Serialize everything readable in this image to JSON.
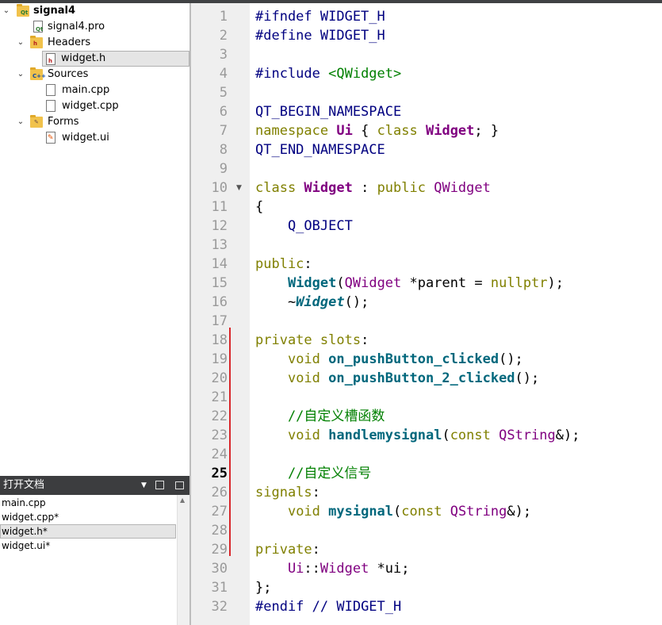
{
  "project_tree": {
    "project": "signal4",
    "pro_file": "signal4.pro",
    "headers_label": "Headers",
    "headers": [
      "widget.h"
    ],
    "sources_label": "Sources",
    "sources": [
      "main.cpp",
      "widget.cpp"
    ],
    "forms_label": "Forms",
    "forms": [
      "widget.ui"
    ]
  },
  "open_docs": {
    "title": "打开文档",
    "items": [
      "main.cpp",
      "widget.cpp*",
      "widget.h*",
      "widget.ui*"
    ],
    "selected_index": 2
  },
  "editor": {
    "current_line": 25,
    "lines": [
      {
        "n": "1",
        "tokens": [
          {
            "t": "#ifndef WIDGET_H",
            "c": "pp"
          }
        ]
      },
      {
        "n": "2",
        "tokens": [
          {
            "t": "#define WIDGET_H",
            "c": "pp"
          }
        ]
      },
      {
        "n": "3",
        "tokens": []
      },
      {
        "n": "4",
        "tokens": [
          {
            "t": "#include ",
            "c": "pp"
          },
          {
            "t": "<QWidget>",
            "c": "inc"
          }
        ]
      },
      {
        "n": "5",
        "tokens": []
      },
      {
        "n": "6",
        "tokens": [
          {
            "t": "QT_BEGIN_NAMESPACE",
            "c": "mac"
          }
        ]
      },
      {
        "n": "7",
        "tokens": [
          {
            "t": "namespace ",
            "c": "kw"
          },
          {
            "t": "Ui",
            "c": "ty"
          },
          {
            "t": " { ",
            "c": "sym"
          },
          {
            "t": "class ",
            "c": "kw"
          },
          {
            "t": "Widget",
            "c": "ty"
          },
          {
            "t": "; }",
            "c": "sym"
          }
        ]
      },
      {
        "n": "8",
        "tokens": [
          {
            "t": "QT_END_NAMESPACE",
            "c": "mac"
          }
        ]
      },
      {
        "n": "9",
        "tokens": []
      },
      {
        "n": "10",
        "tokens": [
          {
            "t": "class ",
            "c": "kw"
          },
          {
            "t": "Widget",
            "c": "ty"
          },
          {
            "t": " : ",
            "c": "sym"
          },
          {
            "t": "public ",
            "c": "kw"
          },
          {
            "t": "QWidget",
            "c": "ty2"
          }
        ]
      },
      {
        "n": "11",
        "tokens": [
          {
            "t": "{",
            "c": "sym"
          }
        ]
      },
      {
        "n": "12",
        "tokens": [
          {
            "t": "    Q_OBJECT",
            "c": "mac"
          }
        ]
      },
      {
        "n": "13",
        "tokens": []
      },
      {
        "n": "14",
        "tokens": [
          {
            "t": "public",
            "c": "kw"
          },
          {
            "t": ":",
            "c": "sym"
          }
        ]
      },
      {
        "n": "15",
        "tokens": [
          {
            "t": "    ",
            "c": "sym"
          },
          {
            "t": "Widget",
            "c": "fn"
          },
          {
            "t": "(",
            "c": "sym"
          },
          {
            "t": "QWidget",
            "c": "ty2"
          },
          {
            "t": " *parent = ",
            "c": "sym"
          },
          {
            "t": "nullptr",
            "c": "kw"
          },
          {
            "t": ");",
            "c": "sym"
          }
        ]
      },
      {
        "n": "16",
        "tokens": [
          {
            "t": "    ~",
            "c": "sym"
          },
          {
            "t": "Widget",
            "c": "fni"
          },
          {
            "t": "();",
            "c": "sym"
          }
        ]
      },
      {
        "n": "17",
        "tokens": []
      },
      {
        "n": "18",
        "tokens": [
          {
            "t": "private slots",
            "c": "kw"
          },
          {
            "t": ":",
            "c": "sym"
          }
        ]
      },
      {
        "n": "19",
        "tokens": [
          {
            "t": "    ",
            "c": "sym"
          },
          {
            "t": "void ",
            "c": "kw"
          },
          {
            "t": "on_pushButton_clicked",
            "c": "fn"
          },
          {
            "t": "();",
            "c": "sym"
          }
        ]
      },
      {
        "n": "20",
        "tokens": [
          {
            "t": "    ",
            "c": "sym"
          },
          {
            "t": "void ",
            "c": "kw"
          },
          {
            "t": "on_pushButton_2_clicked",
            "c": "fn"
          },
          {
            "t": "();",
            "c": "sym"
          }
        ]
      },
      {
        "n": "21",
        "tokens": []
      },
      {
        "n": "22",
        "tokens": [
          {
            "t": "    //自定义槽函数",
            "c": "cm"
          }
        ]
      },
      {
        "n": "23",
        "tokens": [
          {
            "t": "    ",
            "c": "sym"
          },
          {
            "t": "void ",
            "c": "kw"
          },
          {
            "t": "handlemysignal",
            "c": "fn"
          },
          {
            "t": "(",
            "c": "sym"
          },
          {
            "t": "const ",
            "c": "kw"
          },
          {
            "t": "QString",
            "c": "ty2"
          },
          {
            "t": "&);",
            "c": "sym"
          }
        ]
      },
      {
        "n": "24",
        "tokens": []
      },
      {
        "n": "25",
        "tokens": [
          {
            "t": "    //自定义信号",
            "c": "cm"
          }
        ]
      },
      {
        "n": "26",
        "tokens": [
          {
            "t": "signals",
            "c": "kw"
          },
          {
            "t": ":",
            "c": "sym"
          }
        ]
      },
      {
        "n": "27",
        "tokens": [
          {
            "t": "    ",
            "c": "sym"
          },
          {
            "t": "void ",
            "c": "kw"
          },
          {
            "t": "mysignal",
            "c": "fn"
          },
          {
            "t": "(",
            "c": "sym"
          },
          {
            "t": "const ",
            "c": "kw"
          },
          {
            "t": "QString",
            "c": "ty2"
          },
          {
            "t": "&);",
            "c": "sym"
          }
        ]
      },
      {
        "n": "28",
        "tokens": []
      },
      {
        "n": "29",
        "tokens": [
          {
            "t": "private",
            "c": "kw"
          },
          {
            "t": ":",
            "c": "sym"
          }
        ]
      },
      {
        "n": "30",
        "tokens": [
          {
            "t": "    Ui",
            "c": "ty2"
          },
          {
            "t": "::",
            "c": "sym"
          },
          {
            "t": "Widget",
            "c": "ty2"
          },
          {
            "t": " *ui;",
            "c": "sym"
          }
        ]
      },
      {
        "n": "31",
        "tokens": [
          {
            "t": "};",
            "c": "sym"
          }
        ]
      },
      {
        "n": "32",
        "tokens": [
          {
            "t": "#endif ",
            "c": "pp"
          },
          {
            "t": "// WIDGET_H",
            "c": "pp"
          }
        ]
      }
    ]
  }
}
